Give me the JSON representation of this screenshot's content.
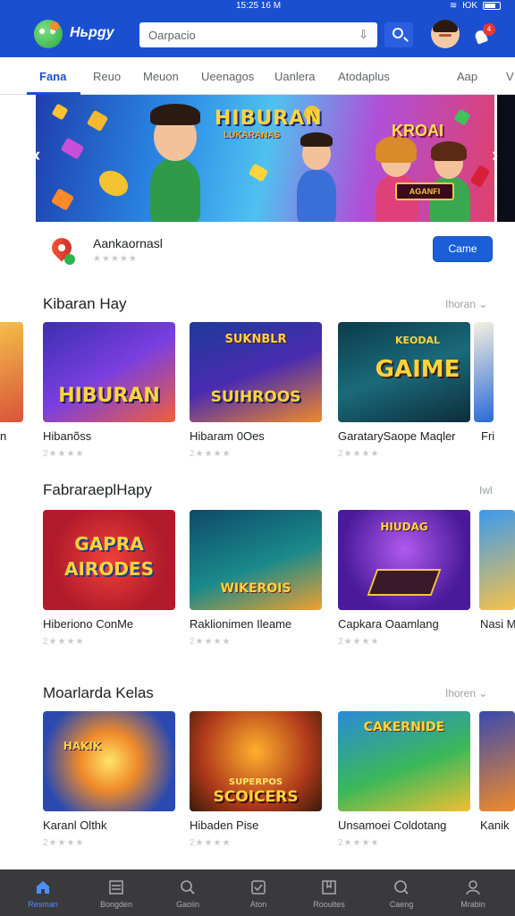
{
  "status_bar": {
    "time": "15:25 16 M",
    "right_text": "ЮK"
  },
  "app_bar": {
    "brand": "Ньрgy",
    "search_placeholder": "Oarpacio"
  },
  "notification_count": "4",
  "tabs": [
    {
      "label": "Fana",
      "active": true
    },
    {
      "label": "Reuo"
    },
    {
      "label": "Meuon"
    },
    {
      "label": "Ueenagos"
    },
    {
      "label": "Uanlera"
    },
    {
      "label": "Atodaplus"
    },
    {
      "label": "Aap"
    },
    {
      "label": "V"
    }
  ],
  "hero": {
    "title": "HIBURAN",
    "subtitle": "LUKARANAS",
    "badge_title": "KROAI",
    "badge_subtitle": "AGANFI"
  },
  "featured_app": {
    "name": "Aankaornasl",
    "rating": "★★★★★",
    "button": "Came"
  },
  "sections": [
    {
      "title": "Kibaran Hay",
      "more": "Ihoran",
      "cards": [
        {
          "title": "Hibanõss",
          "rating": "2★★★★",
          "thumb_label": "HIBURAN"
        },
        {
          "title": "Hibaram 0Oes",
          "rating": "2★★★★",
          "thumb_label": "SUIHROOS",
          "thumb_top": "SUKNBLR"
        },
        {
          "title": "GaratarySaope Maqler",
          "rating": "2★★★★",
          "thumb_label": "GAIME",
          "thumb_top": "KEODAL"
        }
      ],
      "partial_left_label": "n",
      "partial_right_label": "Fri"
    },
    {
      "title": "FabraraeplHapy",
      "more": "Iwl",
      "cards": [
        {
          "title": "Hiberiono ConMe",
          "rating": "2★★★★",
          "thumb_label": "AIRODES",
          "thumb_top": "GAPRA"
        },
        {
          "title": "Raklionimen Ileame",
          "rating": "2★★★★",
          "thumb_label": "WIKEROIS"
        },
        {
          "title": "Capkara Oaamlang",
          "rating": "2★★★★",
          "thumb_label": "HIUDAG"
        }
      ],
      "partial_right_label": "Nasi M"
    },
    {
      "title": "Moarlarda Kelas",
      "more": "Ihoren",
      "cards": [
        {
          "title": "Karanl Olthk",
          "rating": "2★★★★",
          "thumb_label": "HAKIK"
        },
        {
          "title": "Hibaden Pise",
          "rating": "2★★★★",
          "thumb_label": "SCOICERS",
          "thumb_top": "SUPERPOS"
        },
        {
          "title": "Unsamoei Coldotang",
          "rating": "2★★★★",
          "thumb_label": "CAKERNIDE"
        }
      ],
      "partial_right_label": "Kanik"
    }
  ],
  "bottom_nav": [
    {
      "label": "Resman",
      "icon": "home-icon",
      "active": true
    },
    {
      "label": "Bongden",
      "icon": "list-icon"
    },
    {
      "label": "Gaoiin",
      "icon": "search-icon"
    },
    {
      "label": "Aton",
      "icon": "check-square-icon"
    },
    {
      "label": "Rooultes",
      "icon": "bookmark-icon"
    },
    {
      "label": "Caeng",
      "icon": "search-icon"
    },
    {
      "label": "Mrabin",
      "icon": "person-icon"
    }
  ],
  "colors": {
    "primary": "#1a4fd0",
    "button": "#1a5fd8",
    "nav_bg": "#3a3a3c",
    "nav_active": "#4f8dff"
  }
}
